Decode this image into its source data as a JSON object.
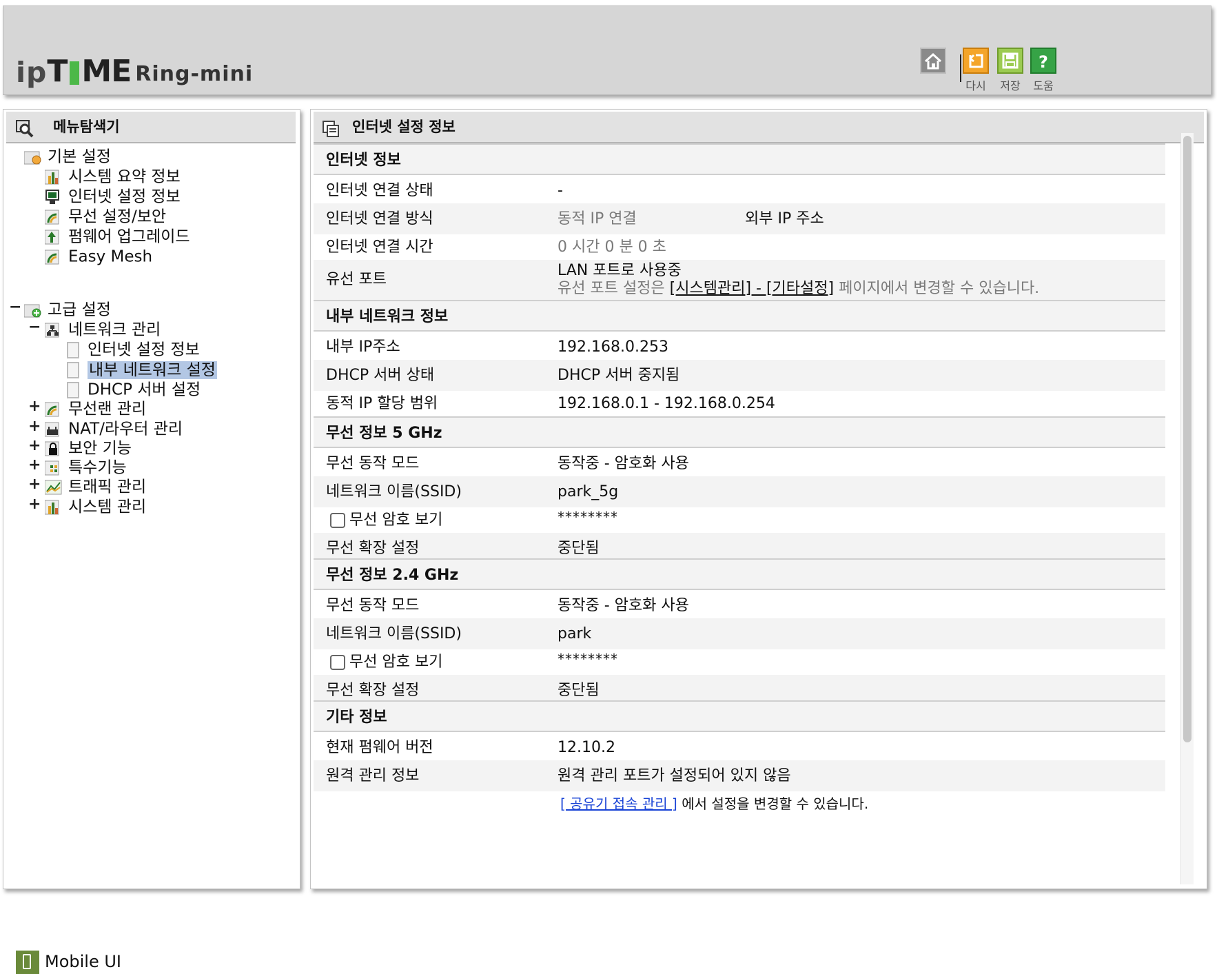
{
  "header": {
    "logo": {
      "ip": "ip",
      "t": "T",
      "me": "ME",
      "model": "Ring-mini"
    },
    "toolbar": {
      "home_label": "",
      "restart_label": "다시",
      "save_label": "저장",
      "help_label": "도움"
    }
  },
  "left": {
    "title": "메뉴탐색기",
    "basic": {
      "label": "기본 설정",
      "items": [
        "시스템 요약 정보",
        "인터넷 설정 정보",
        "무선 설정/보안",
        "펌웨어 업그레이드",
        "Easy Mesh"
      ]
    },
    "advanced": {
      "toggle": "−",
      "label": "고급 설정",
      "network": {
        "toggle": "−",
        "label": "네트워크 관리",
        "items": [
          "인터넷 설정 정보",
          "내부 네트워크 설정",
          "DHCP 서버 설정"
        ]
      },
      "others": [
        {
          "toggle": "+",
          "label": "무선랜 관리"
        },
        {
          "toggle": "+",
          "label": "NAT/라우터 관리"
        },
        {
          "toggle": "+",
          "label": "보안 기능"
        },
        {
          "toggle": "+",
          "label": "특수기능"
        },
        {
          "toggle": "+",
          "label": "트래픽 관리"
        },
        {
          "toggle": "+",
          "label": "시스템 관리"
        }
      ]
    },
    "mobile": "Mobile UI"
  },
  "right": {
    "title": "인터넷 설정 정보",
    "internet": {
      "header": "인터넷 정보",
      "status_label": "인터넷 연결 상태",
      "status_value": "-",
      "method_label": "인터넷 연결 방식",
      "method_value": "동적 IP 연결",
      "external_ip_label": "외부 IP 주소",
      "time_label": "인터넷 연결 시간",
      "time_value": "0 시간 0 분 0 초",
      "wired_label": "유선 포트",
      "wired_value": "LAN 포트로 사용중",
      "wired_note_pre": "유선 포트 설정은 ",
      "wired_note_link": "[시스템관리] - [기타설정]",
      "wired_note_post": " 페이지에서 변경할 수 있습니다."
    },
    "lan": {
      "header": "내부 네트워크 정보",
      "ip_label": "내부 IP주소",
      "ip_value": "192.168.0.253",
      "dhcp_label": "DHCP 서버 상태",
      "dhcp_value": "DHCP 서버 중지됨",
      "range_label": "동적 IP 할당 범위",
      "range_value": "192.168.0.1 -  192.168.0.254"
    },
    "wireless5": {
      "header": "무선 정보 5 GHz",
      "mode_label": "무선 동작 모드",
      "mode_value": "동작중 - 암호화 사용",
      "ssid_label": "네트워크 이름(SSID)",
      "ssid_value": "park_5g",
      "pw_label": "무선 암호 보기",
      "pw_value": "********",
      "ext_label": "무선 확장 설정",
      "ext_value": "중단됨"
    },
    "wireless24": {
      "header": "무선 정보 2.4 GHz",
      "mode_label": "무선 동작 모드",
      "mode_value": "동작중 - 암호화 사용",
      "ssid_label": "네트워크 이름(SSID)",
      "ssid_value": "park",
      "pw_label": "무선 암호 보기",
      "pw_value": "********",
      "ext_label": "무선 확장 설정",
      "ext_value": "중단됨"
    },
    "other": {
      "header": "기타 정보",
      "fw_label": "현재 펌웨어 버전",
      "fw_value": "12.10.2",
      "remote_label": "원격 관리 정보",
      "remote_value": "원격 관리 포트가 설정되어 있지 않음",
      "remote_link": "[ 공유기 접속 관리 ]",
      "remote_note": " 에서 설정을 변경할 수 있습니다."
    }
  }
}
